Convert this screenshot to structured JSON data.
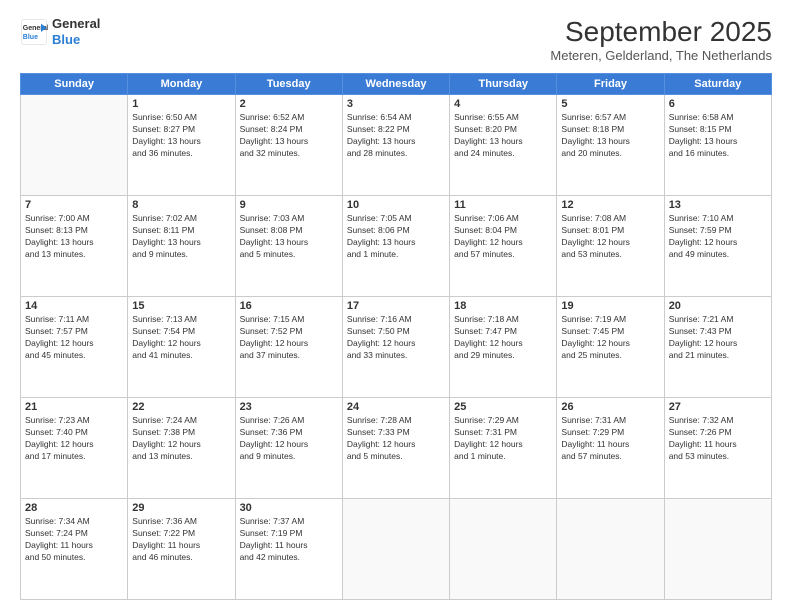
{
  "header": {
    "logo_line1": "General",
    "logo_line2": "Blue",
    "month_title": "September 2025",
    "location": "Meteren, Gelderland, The Netherlands"
  },
  "days_of_week": [
    "Sunday",
    "Monday",
    "Tuesday",
    "Wednesday",
    "Thursday",
    "Friday",
    "Saturday"
  ],
  "weeks": [
    [
      {
        "day": "",
        "info": ""
      },
      {
        "day": "1",
        "info": "Sunrise: 6:50 AM\nSunset: 8:27 PM\nDaylight: 13 hours\nand 36 minutes."
      },
      {
        "day": "2",
        "info": "Sunrise: 6:52 AM\nSunset: 8:24 PM\nDaylight: 13 hours\nand 32 minutes."
      },
      {
        "day": "3",
        "info": "Sunrise: 6:54 AM\nSunset: 8:22 PM\nDaylight: 13 hours\nand 28 minutes."
      },
      {
        "day": "4",
        "info": "Sunrise: 6:55 AM\nSunset: 8:20 PM\nDaylight: 13 hours\nand 24 minutes."
      },
      {
        "day": "5",
        "info": "Sunrise: 6:57 AM\nSunset: 8:18 PM\nDaylight: 13 hours\nand 20 minutes."
      },
      {
        "day": "6",
        "info": "Sunrise: 6:58 AM\nSunset: 8:15 PM\nDaylight: 13 hours\nand 16 minutes."
      }
    ],
    [
      {
        "day": "7",
        "info": "Sunrise: 7:00 AM\nSunset: 8:13 PM\nDaylight: 13 hours\nand 13 minutes."
      },
      {
        "day": "8",
        "info": "Sunrise: 7:02 AM\nSunset: 8:11 PM\nDaylight: 13 hours\nand 9 minutes."
      },
      {
        "day": "9",
        "info": "Sunrise: 7:03 AM\nSunset: 8:08 PM\nDaylight: 13 hours\nand 5 minutes."
      },
      {
        "day": "10",
        "info": "Sunrise: 7:05 AM\nSunset: 8:06 PM\nDaylight: 13 hours\nand 1 minute."
      },
      {
        "day": "11",
        "info": "Sunrise: 7:06 AM\nSunset: 8:04 PM\nDaylight: 12 hours\nand 57 minutes."
      },
      {
        "day": "12",
        "info": "Sunrise: 7:08 AM\nSunset: 8:01 PM\nDaylight: 12 hours\nand 53 minutes."
      },
      {
        "day": "13",
        "info": "Sunrise: 7:10 AM\nSunset: 7:59 PM\nDaylight: 12 hours\nand 49 minutes."
      }
    ],
    [
      {
        "day": "14",
        "info": "Sunrise: 7:11 AM\nSunset: 7:57 PM\nDaylight: 12 hours\nand 45 minutes."
      },
      {
        "day": "15",
        "info": "Sunrise: 7:13 AM\nSunset: 7:54 PM\nDaylight: 12 hours\nand 41 minutes."
      },
      {
        "day": "16",
        "info": "Sunrise: 7:15 AM\nSunset: 7:52 PM\nDaylight: 12 hours\nand 37 minutes."
      },
      {
        "day": "17",
        "info": "Sunrise: 7:16 AM\nSunset: 7:50 PM\nDaylight: 12 hours\nand 33 minutes."
      },
      {
        "day": "18",
        "info": "Sunrise: 7:18 AM\nSunset: 7:47 PM\nDaylight: 12 hours\nand 29 minutes."
      },
      {
        "day": "19",
        "info": "Sunrise: 7:19 AM\nSunset: 7:45 PM\nDaylight: 12 hours\nand 25 minutes."
      },
      {
        "day": "20",
        "info": "Sunrise: 7:21 AM\nSunset: 7:43 PM\nDaylight: 12 hours\nand 21 minutes."
      }
    ],
    [
      {
        "day": "21",
        "info": "Sunrise: 7:23 AM\nSunset: 7:40 PM\nDaylight: 12 hours\nand 17 minutes."
      },
      {
        "day": "22",
        "info": "Sunrise: 7:24 AM\nSunset: 7:38 PM\nDaylight: 12 hours\nand 13 minutes."
      },
      {
        "day": "23",
        "info": "Sunrise: 7:26 AM\nSunset: 7:36 PM\nDaylight: 12 hours\nand 9 minutes."
      },
      {
        "day": "24",
        "info": "Sunrise: 7:28 AM\nSunset: 7:33 PM\nDaylight: 12 hours\nand 5 minutes."
      },
      {
        "day": "25",
        "info": "Sunrise: 7:29 AM\nSunset: 7:31 PM\nDaylight: 12 hours\nand 1 minute."
      },
      {
        "day": "26",
        "info": "Sunrise: 7:31 AM\nSunset: 7:29 PM\nDaylight: 11 hours\nand 57 minutes."
      },
      {
        "day": "27",
        "info": "Sunrise: 7:32 AM\nSunset: 7:26 PM\nDaylight: 11 hours\nand 53 minutes."
      }
    ],
    [
      {
        "day": "28",
        "info": "Sunrise: 7:34 AM\nSunset: 7:24 PM\nDaylight: 11 hours\nand 50 minutes."
      },
      {
        "day": "29",
        "info": "Sunrise: 7:36 AM\nSunset: 7:22 PM\nDaylight: 11 hours\nand 46 minutes."
      },
      {
        "day": "30",
        "info": "Sunrise: 7:37 AM\nSunset: 7:19 PM\nDaylight: 11 hours\nand 42 minutes."
      },
      {
        "day": "",
        "info": ""
      },
      {
        "day": "",
        "info": ""
      },
      {
        "day": "",
        "info": ""
      },
      {
        "day": "",
        "info": ""
      }
    ]
  ]
}
